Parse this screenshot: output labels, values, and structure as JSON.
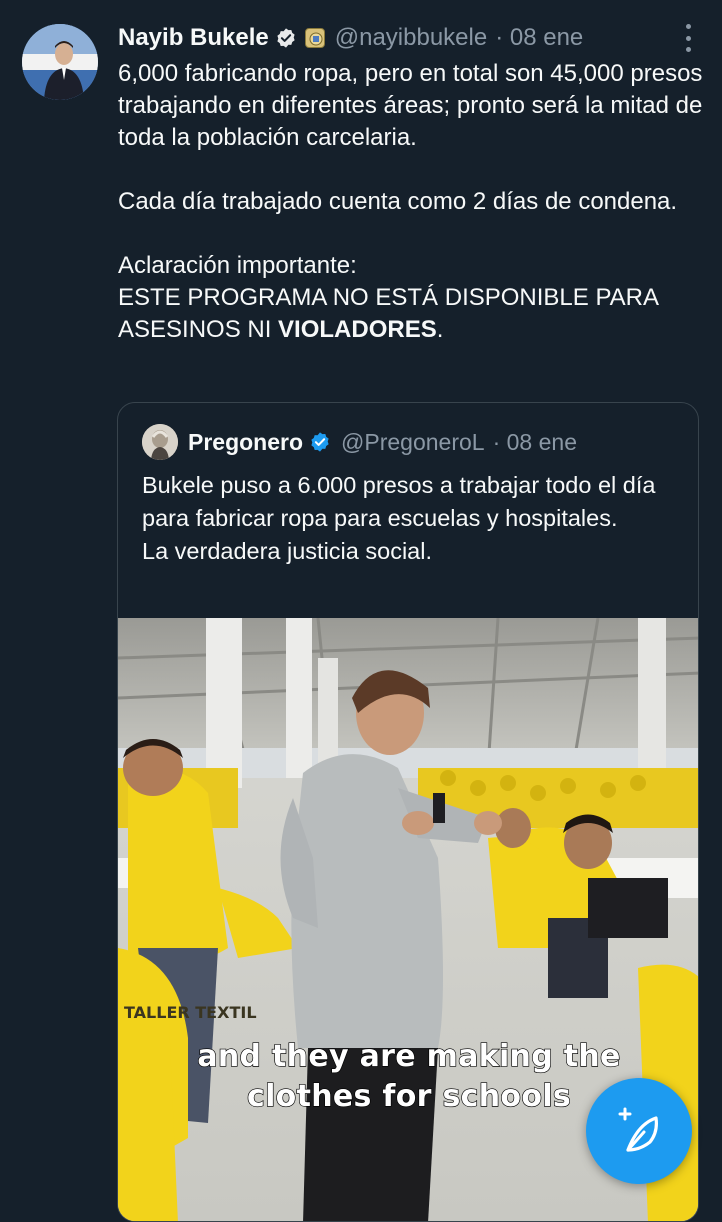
{
  "tweet": {
    "author_name": "Nayib Bukele",
    "handle": "@nayibbukele",
    "date": "· 08 ene",
    "text_p1": "6,000 fabricando ropa, pero en total son 45,000 presos trabajando en diferentes áreas; pronto será la mitad de toda la población carcelaria.",
    "text_p2": "Cada día trabajado cuenta como 2 días de condena.",
    "text_p3_line1": "Aclaración importante:",
    "text_p3_line2": "ESTE PROGRAMA NO ESTÁ DISPONIBLE PARA ASESINOS NI ",
    "text_p3_bold": "VIOLADORES",
    "text_p3_end": "."
  },
  "quoted_tweet": {
    "author_name": "Pregonero",
    "handle": "@PregoneroL",
    "date": "· 08 ene",
    "text_line1": "Bukele puso a 6.000 presos a trabajar todo el día para fabricar ropa para escuelas y hospitales.",
    "text_line2": "La verdadera justicia social.",
    "video_caption_line1": "and they are making the",
    "video_caption_line2": "clothes for schools",
    "video_sign_text": "TALLER TEXTIL"
  },
  "icons": {
    "verified": "verified-badge-icon",
    "gov_badge": "government-badge-icon",
    "more": "more-options-icon",
    "compose": "compose-tweet-icon"
  },
  "colors": {
    "background": "#15202b",
    "text": "#f7f9f9",
    "secondary": "#8b98a5",
    "accent": "#1d9bf0",
    "border": "#38444d",
    "uniform": "#f2d31b"
  }
}
